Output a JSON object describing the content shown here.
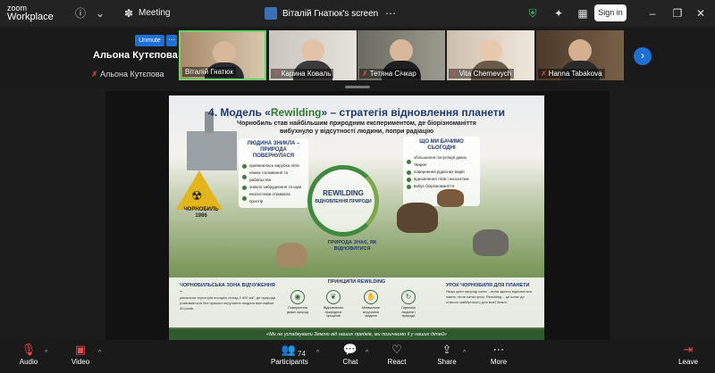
{
  "app": {
    "brand_top": "zoom",
    "brand_bottom": "Workplace"
  },
  "titlebar": {
    "meeting_label": "Meeting",
    "share_label": "Віталій Гнатюк's screen",
    "signin_label": "Sign in"
  },
  "spotlight": {
    "name": "Альона Кутєпова",
    "sub_label": "Альона Кутєпова",
    "unmute_label": "Unmute"
  },
  "participants": [
    {
      "name": "Віталій Гнатюк"
    },
    {
      "name": "Карина Коваль"
    },
    {
      "name": "Тетяна Січкар"
    },
    {
      "name": "Vita Chernevych"
    },
    {
      "name": "Hanna Tabakova"
    }
  ],
  "slide": {
    "title_prefix": "4. Модель «",
    "title_accent": "Rewilding",
    "title_suffix": "» – стратегія відновлення планети",
    "subtitle": "Чорнобиль став найбільшим природним експериментом, де біорізноманіття вибухнуло у відсутності людини, попри радіацію",
    "left_box": {
      "heading": "ЛЮДИНА ЗНИКЛА – ПРИРОДА ПОВЕРНУЛАСЯ",
      "items": [
        "припинилась вирубка лісів",
        "немає полювання та рибальства",
        "зникло забруднення та шум",
        "екосистема отримала простір"
      ]
    },
    "right_box": {
      "heading": "ЩО МИ БАЧИМО СЬОГОДНІ",
      "items": [
        "збільшення популяцій диких тварин",
        "повернення рідкісних видів",
        "відновлення лісів і екосистем",
        "вибух біорізноманіття"
      ]
    },
    "ring_title": "REWILDING",
    "ring_sub": "ВІДНОВЛЕННЯ ПРИРОДИ",
    "motto": "ПРИРОДА ЗНАЄ, ЯК ВІДНОВИТИСЯ",
    "sign_text": "ЧОРНОБИЛЬ 1986",
    "zone_heading": "ЧОРНОБИЛЬСЬКА ЗОНА ВІДЧУЖЕННЯ –",
    "zone_text": "унікальна територія площею понад 2 600 км², де природа розвивається без прямого втручання людини вже майже 40 років.",
    "principles_heading": "ПРИНЦИПИ REWILDING",
    "principles": [
      "Повернення диких природ",
      "Відновлення природних процесів",
      "Мінімальне втручання людини",
      "Гармонія людини і природи"
    ],
    "lesson_heading": "УРОК ЧОРНОБИЛЯ ДЛЯ ПЛАНЕТИ",
    "lesson_text": "Якщо дати природі шанс – вона здатна відновитися навіть після катастроф. Rewilding – це шлях до сталого майбутнього для всієї Землі.",
    "footer": "«Ми не успадкували Землю від наших предків, ми позичаємо її у наших дітей»"
  },
  "toolbar": {
    "audio": "Audio",
    "video": "Video",
    "participants": "Participants",
    "participants_count": "74",
    "chat": "Chat",
    "react": "React",
    "share": "Share",
    "more": "More",
    "leave": "Leave"
  }
}
